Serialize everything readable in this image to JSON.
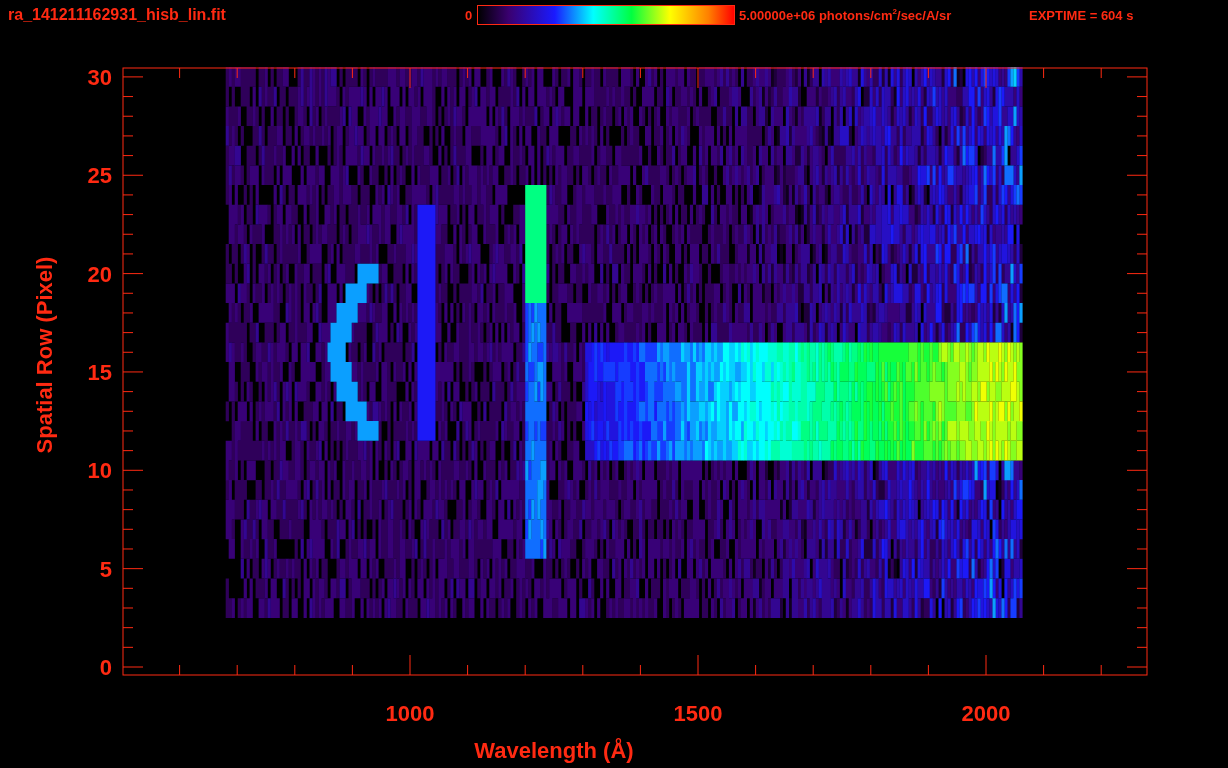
{
  "title": "ra_141211162931_hisb_lin.fit",
  "colorbar": {
    "min_label": "0",
    "max_label": "5.00000e+06 photons/cm$^{2}$/sec/A/sr"
  },
  "exposure": "EXPTIME = 604 s",
  "plot": {
    "y_label": "Spatial Row (Pixel)",
    "x_label": "Wavelength (Å)",
    "y_ticks": [
      "30",
      "25",
      "20",
      "15",
      "10",
      "5",
      "0"
    ],
    "x_ticks": [
      "1000",
      "1500",
      "2000"
    ]
  }
}
